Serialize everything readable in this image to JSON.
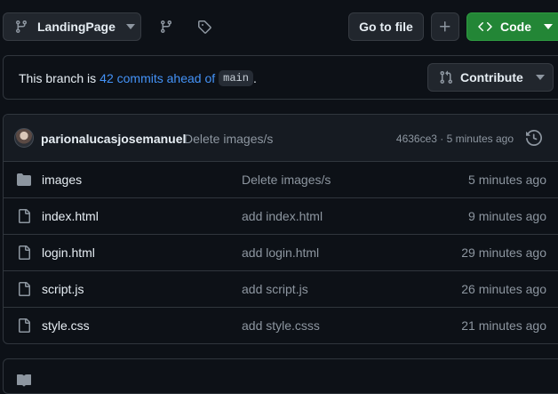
{
  "toolbar": {
    "branch_label": "LandingPage",
    "goto_label": "Go to file",
    "plus_label": "+",
    "code_label": "Code"
  },
  "branch_info": {
    "prefix": "This branch is",
    "link": "42 commits ahead of",
    "base": "main",
    "suffix": ".",
    "contribute_label": "Contribute"
  },
  "last_commit": {
    "author": "parionalucasjosemanuel",
    "message": "Delete images/s",
    "meta": "4636ce3 · 5 minutes ago"
  },
  "files": [
    {
      "name": "images",
      "type": "folder",
      "message": "Delete images/s",
      "time": "5 minutes ago"
    },
    {
      "name": "index.html",
      "type": "file",
      "message": "add index.html",
      "time": "9 minutes ago"
    },
    {
      "name": "login.html",
      "type": "file",
      "message": "add login.html",
      "time": "29 minutes ago"
    },
    {
      "name": "script.js",
      "type": "file",
      "message": "add script.js",
      "time": "26 minutes ago"
    },
    {
      "name": "style.css",
      "type": "file",
      "message": "add style.csss",
      "time": "21 minutes ago"
    }
  ],
  "icons": {
    "branch": "git-branch-icon",
    "branches": "branches-icon",
    "tags": "tag-icon",
    "code": "code-icon",
    "pull_request": "git-pull-request-icon",
    "history": "history-icon",
    "folder": "folder-icon",
    "file": "file-icon",
    "readme": "book-icon"
  },
  "colors": {
    "background": "#0d1117",
    "primary_button": "#238636",
    "link": "#4493f8",
    "muted_text": "#8d96a0",
    "border": "#30363d"
  }
}
